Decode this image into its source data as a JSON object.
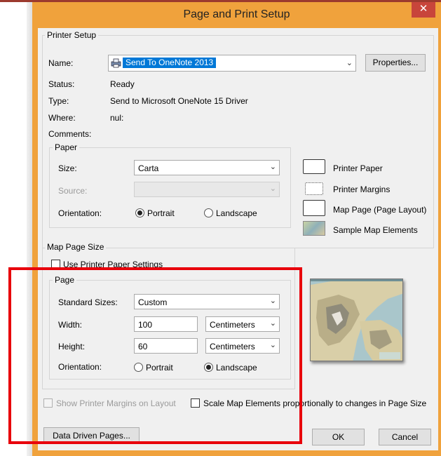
{
  "window": {
    "title": "Page and Print Setup",
    "close_glyph": "✕"
  },
  "printer_setup": {
    "group_label": "Printer Setup",
    "name_label": "Name:",
    "name_value": "Send To OneNote 2013",
    "properties_label": "Properties...",
    "status_label": "Status:",
    "status_value": "Ready",
    "type_label": "Type:",
    "type_value": "Send to Microsoft OneNote 15 Driver",
    "where_label": "Where:",
    "where_value": "nul:",
    "comments_label": "Comments:"
  },
  "paper": {
    "group_label": "Paper",
    "size_label": "Size:",
    "size_value": "Carta",
    "source_label": "Source:",
    "source_value": "",
    "orientation_label": "Orientation:",
    "portrait_label": "Portrait",
    "landscape_label": "Landscape",
    "orientation_selected": "portrait"
  },
  "legend": {
    "printer_paper": "Printer Paper",
    "printer_margins": "Printer Margins",
    "map_page": "Map Page (Page Layout)",
    "sample_elements": "Sample Map Elements"
  },
  "map_page_size": {
    "group_label": "Map Page Size",
    "use_printer_label": "Use Printer Paper Settings",
    "use_printer_checked": false,
    "page_group_label": "Page",
    "standard_sizes_label": "Standard Sizes:",
    "standard_sizes_value": "Custom",
    "width_label": "Width:",
    "width_value": "100",
    "width_unit": "Centimeters",
    "height_label": "Height:",
    "height_value": "60",
    "height_unit": "Centimeters",
    "orientation_label": "Orientation:",
    "portrait_label": "Portrait",
    "landscape_label": "Landscape",
    "orientation_selected": "landscape"
  },
  "options": {
    "show_margins_label": "Show Printer Margins on Layout",
    "show_margins_checked": false,
    "scale_elements_label": "Scale Map Elements proportionally to changes in Page Size",
    "scale_elements_checked": false
  },
  "footer": {
    "data_driven_label": "Data Driven Pages...",
    "ok_label": "OK",
    "cancel_label": "Cancel"
  },
  "colors": {
    "title_bar": "#f0a23c",
    "close_button": "#c8453b",
    "selection": "#0078d7",
    "annotation_box": "#e8000b"
  }
}
